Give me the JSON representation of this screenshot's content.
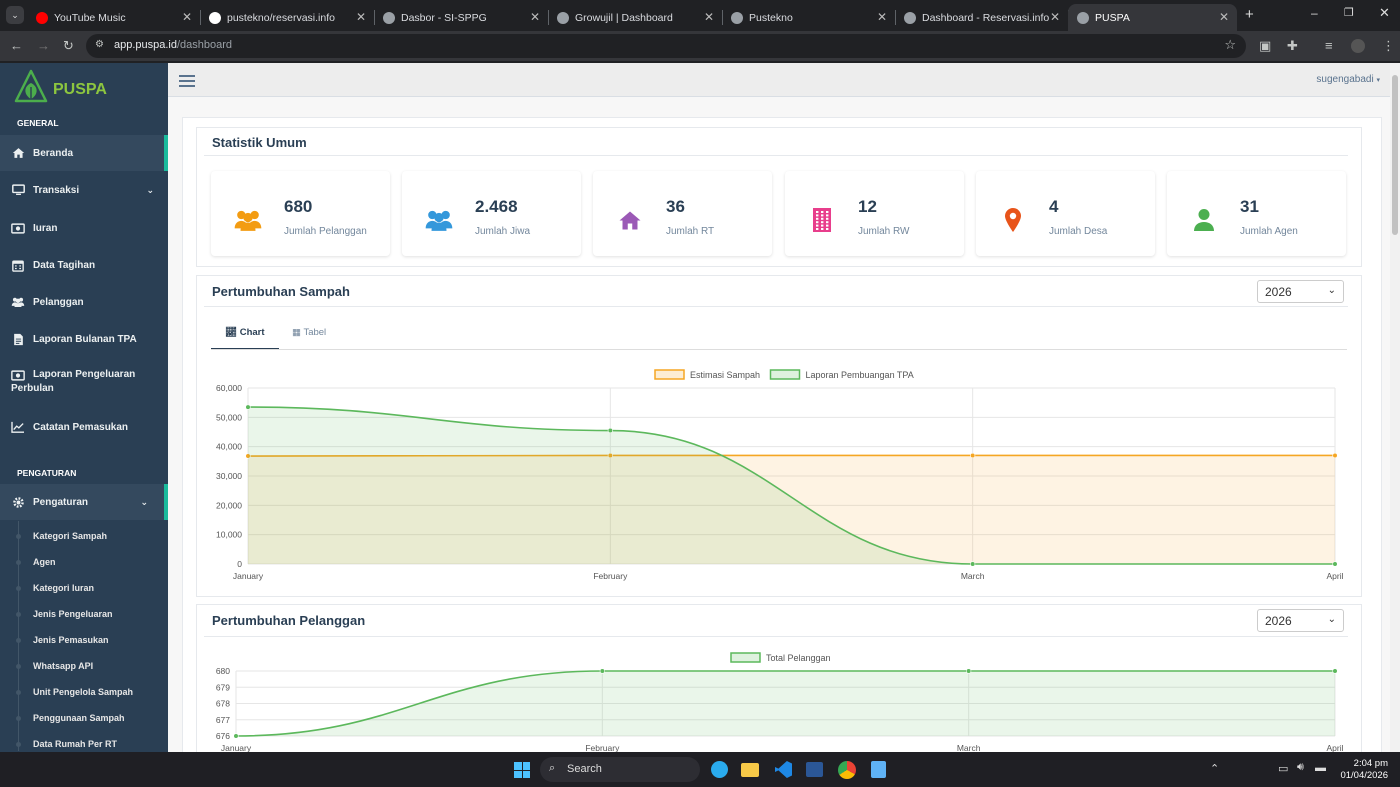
{
  "browser": {
    "tabs": [
      {
        "title": "YouTube Music",
        "color": "#ff0000"
      },
      {
        "title": "pustekno/reservasi.info",
        "color": "#ffffff"
      },
      {
        "title": "Dasbor - SI-SPPG",
        "color": "#9aa0a6"
      },
      {
        "title": "Growujil | Dashboard",
        "color": "#9aa0a6"
      },
      {
        "title": "Pustekno",
        "color": "#9aa0a6"
      },
      {
        "title": "Dashboard - Reservasi.info",
        "color": "#9aa0a6"
      },
      {
        "title": "PUSPA",
        "color": "#9aa0a6"
      }
    ],
    "url_host": "app.puspa.id",
    "url_path": "/dashboard"
  },
  "brand": {
    "name": "PUSPA"
  },
  "sidebar": {
    "general_heading": "GENERAL",
    "items": [
      {
        "label": "Beranda",
        "icon": "home-icon"
      },
      {
        "label": "Transaksi",
        "icon": "monitor-icon"
      },
      {
        "label": "Iuran",
        "icon": "money-icon"
      },
      {
        "label": "Data Tagihan",
        "icon": "calendar-icon"
      },
      {
        "label": "Pelanggan",
        "icon": "users-icon"
      },
      {
        "label": "Laporan Bulanan TPA",
        "icon": "file-icon"
      },
      {
        "label": "Laporan Pengeluaran Perbulan",
        "icon": "money-icon"
      },
      {
        "label": "Catatan Pemasukan",
        "icon": "chart-line-icon"
      }
    ],
    "settings_heading": "PENGATURAN",
    "settings_label": "Pengaturan",
    "sub_items": [
      "Kategori Sampah",
      "Agen",
      "Kategori Iuran",
      "Jenis Pengeluaran",
      "Jenis Pemasukan",
      "Whatsapp API",
      "Unit Pengelola Sampah",
      "Penggunaan Sampah",
      "Data Rumah Per RT"
    ]
  },
  "header": {
    "user": "sugengabadi"
  },
  "stats": {
    "title": "Statistik Umum",
    "items": [
      {
        "value": "680",
        "label": "Jumlah Pelanggan",
        "icon": "users-icon",
        "color": "#f39c12"
      },
      {
        "value": "2.468",
        "label": "Jumlah Jiwa",
        "icon": "users-icon",
        "color": "#3498db"
      },
      {
        "value": "36",
        "label": "Jumlah RT",
        "icon": "home-icon",
        "color": "#9b59b6"
      },
      {
        "value": "12",
        "label": "Jumlah RW",
        "icon": "building-icon",
        "color": "#e83e8c"
      },
      {
        "value": "4",
        "label": "Jumlah Desa",
        "icon": "map-marker-icon",
        "color": "#e8541a"
      },
      {
        "value": "31",
        "label": "Jumlah Agen",
        "icon": "user-icon",
        "color": "#4caf50"
      }
    ]
  },
  "sampah": {
    "title": "Pertumbuhan Sampah",
    "year": "2026",
    "tab_chart": "Chart",
    "tab_table": "Tabel"
  },
  "pelanggan": {
    "title": "Pertumbuhan Pelanggan",
    "year": "2026"
  },
  "chart_data": [
    {
      "type": "area",
      "categories": [
        "January",
        "February",
        "March",
        "April"
      ],
      "series": [
        {
          "name": "Estimasi Sampah",
          "values": [
            36800,
            37000,
            37000,
            37000
          ],
          "color": "#f5a623"
        },
        {
          "name": "Laporan Pembuangan TPA",
          "values": [
            53500,
            45500,
            0,
            0
          ],
          "color": "#5cb85c"
        }
      ],
      "yticks": [
        "0",
        "10,000",
        "20,000",
        "30,000",
        "40,000",
        "50,000",
        "60,000"
      ],
      "ylim": [
        0,
        60000
      ],
      "grid": true,
      "legend": "top-center"
    },
    {
      "type": "area",
      "categories": [
        "January",
        "February",
        "March",
        "April"
      ],
      "series": [
        {
          "name": "Total Pelanggan",
          "values": [
            676,
            680,
            680,
            680
          ],
          "color": "#5cb85c"
        }
      ],
      "yticks": [
        "676",
        "677",
        "678",
        "679",
        "680"
      ],
      "ylim": [
        676,
        680
      ],
      "grid": true,
      "legend": "top-center"
    }
  ],
  "taskbar": {
    "search": "Search",
    "time": "2:04 pm",
    "date": "01/04/2026"
  }
}
